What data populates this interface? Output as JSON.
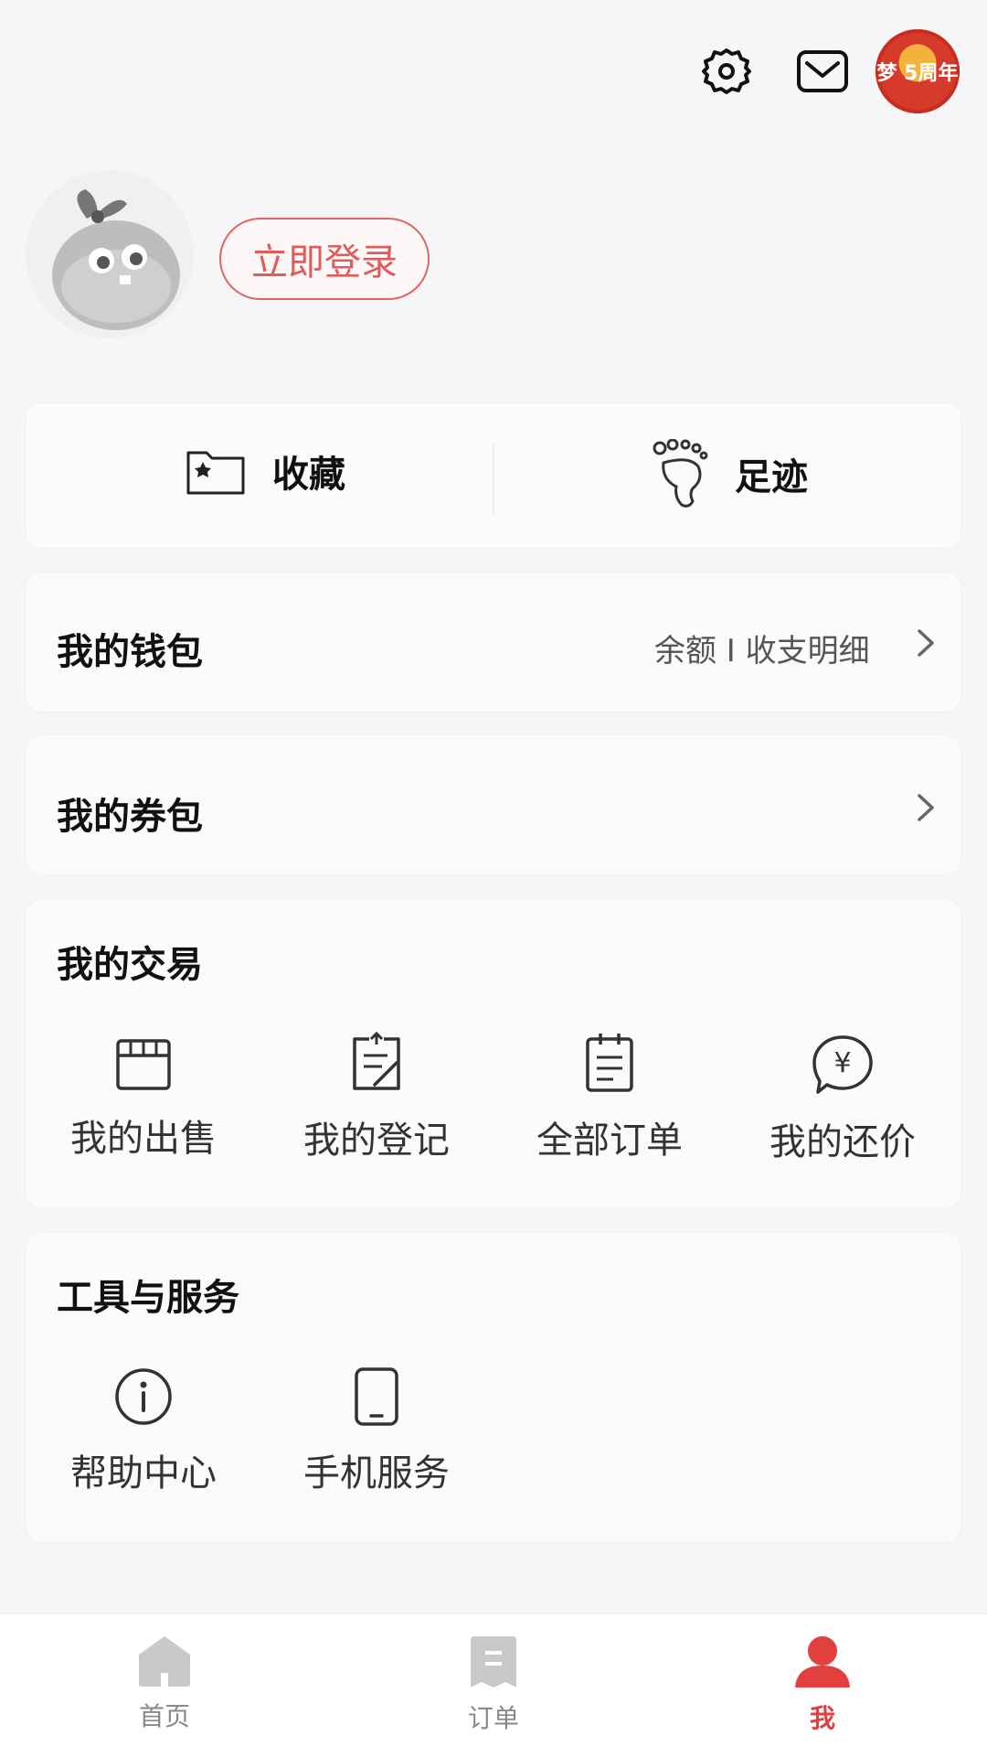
{
  "header": {
    "settings_icon": "gear-icon",
    "message_icon": "mail-icon",
    "promo_badge_text": "梦 5周年"
  },
  "profile": {
    "avatar_icon": "default-avatar-icon",
    "login_label": "立即登录"
  },
  "quick_actions": [
    {
      "label": "收藏",
      "icon": "folder-star-icon"
    },
    {
      "label": "足迹",
      "icon": "footprint-icon"
    }
  ],
  "wallet": {
    "title": "我的钱包",
    "right_text": "余额 I 收支明细"
  },
  "coupons": {
    "title": "我的券包"
  },
  "trades": {
    "title": "我的交易",
    "items": [
      {
        "label": "我的出售",
        "icon": "store-icon"
      },
      {
        "label": "我的登记",
        "icon": "register-doc-icon"
      },
      {
        "label": "全部订单",
        "icon": "order-list-icon"
      },
      {
        "label": "我的还价",
        "icon": "yen-bubble-icon"
      }
    ]
  },
  "tools": {
    "title": "工具与服务",
    "items": [
      {
        "label": "帮助中心",
        "icon": "info-circle-icon"
      },
      {
        "label": "手机服务",
        "icon": "phone-icon"
      }
    ]
  },
  "tabbar": {
    "items": [
      {
        "label": "首页",
        "icon": "home-icon",
        "active": false
      },
      {
        "label": "订单",
        "icon": "order-icon",
        "active": false
      },
      {
        "label": "我",
        "icon": "person-icon",
        "active": true
      }
    ],
    "active_color": "#e23f3f"
  },
  "colors": {
    "accent": "#e15b5b",
    "background": "#f6f6f8"
  }
}
